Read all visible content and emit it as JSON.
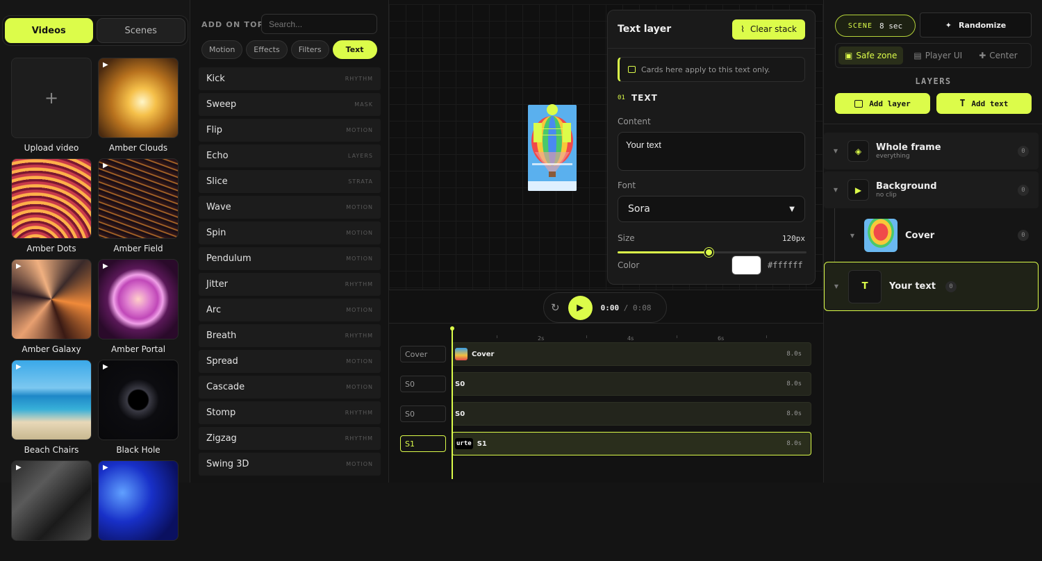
{
  "library": {
    "tabs": [
      {
        "label": "Videos"
      },
      {
        "label": "Scenes"
      }
    ],
    "upload_label": "Upload video",
    "videos": [
      {
        "label": "Amber Clouds"
      },
      {
        "label": "Amber Dots"
      },
      {
        "label": "Amber Field"
      },
      {
        "label": "Amber Galaxy"
      },
      {
        "label": "Amber Portal"
      },
      {
        "label": "Beach Chairs"
      },
      {
        "label": "Black Hole"
      }
    ]
  },
  "effects": {
    "heading": "ADD ON TOP",
    "search_placeholder": "Search...",
    "filters": [
      {
        "label": "Motion"
      },
      {
        "label": "Effects"
      },
      {
        "label": "Filters"
      },
      {
        "label": "Text"
      }
    ],
    "active_filter": "Text",
    "items": [
      {
        "name": "Kick",
        "category": "RHYTHM"
      },
      {
        "name": "Sweep",
        "category": "MASK"
      },
      {
        "name": "Flip",
        "category": "MOTION"
      },
      {
        "name": "Echo",
        "category": "LAYERS"
      },
      {
        "name": "Slice",
        "category": "STRATA"
      },
      {
        "name": "Wave",
        "category": "MOTION"
      },
      {
        "name": "Spin",
        "category": "MOTION"
      },
      {
        "name": "Pendulum",
        "category": "MOTION"
      },
      {
        "name": "Jitter",
        "category": "RHYTHM"
      },
      {
        "name": "Arc",
        "category": "MOTION"
      },
      {
        "name": "Breath",
        "category": "RHYTHM"
      },
      {
        "name": "Spread",
        "category": "MOTION"
      },
      {
        "name": "Cascade",
        "category": "MOTION"
      },
      {
        "name": "Stomp",
        "category": "RHYTHM"
      },
      {
        "name": "Zigzag",
        "category": "RHYTHM"
      },
      {
        "name": "Swing 3D",
        "category": "MOTION"
      }
    ]
  },
  "text_panel": {
    "title": "Text layer",
    "clear_label": "Clear stack",
    "note": "Cards here apply to this text only.",
    "section_num": "01",
    "section_title": "TEXT",
    "content_label": "Content",
    "content_value": "Your text",
    "font_label": "Font",
    "font_value": "Sora",
    "size_label": "Size",
    "size_value": "120px",
    "size_fraction": 0.48,
    "color_label": "Color",
    "color_value": "#ffffff",
    "color_hex_label": "#ffffff"
  },
  "player": {
    "time_current": "0:00",
    "time_separator": "/",
    "time_total": "0:08"
  },
  "timeline": {
    "ticks": [
      "2s",
      "4s",
      "6s"
    ],
    "tracks": [
      {
        "label": "Cover",
        "clip": "Cover",
        "duration": "8.0s"
      },
      {
        "label": "S0",
        "clip": "S0",
        "duration": "8.0s"
      },
      {
        "label": "S0",
        "clip": "S0",
        "duration": "8.0s"
      },
      {
        "label": "S1",
        "clip": "S1",
        "duration": "8.0s",
        "thumb": "urte"
      }
    ]
  },
  "right": {
    "scene_key": "SCENE",
    "scene_value": "8 sec",
    "randomize_label": "Randomize",
    "toggles": [
      {
        "label": "Safe zone"
      },
      {
        "label": "Player UI"
      },
      {
        "label": "Center"
      }
    ],
    "layers_heading": "LAYERS",
    "add_layer_label": "Add layer",
    "add_text_label": "Add text",
    "layers": [
      {
        "name": "Whole frame",
        "sub": "everything",
        "count": "0"
      },
      {
        "name": "Background",
        "sub": "no clip",
        "count": "0"
      },
      {
        "name": "Cover",
        "count": "0"
      },
      {
        "name": "Your text",
        "count": "0",
        "icon_letter": "T"
      }
    ]
  },
  "colors": {
    "accent": "#dcfc4a",
    "bg": "#141414"
  }
}
